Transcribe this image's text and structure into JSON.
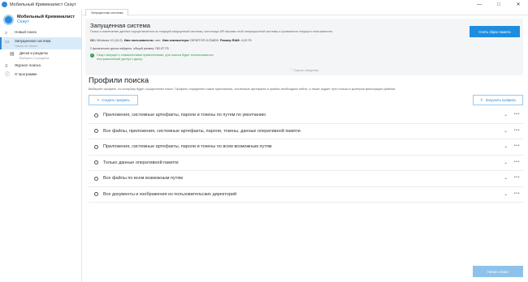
{
  "window": {
    "title": "Мобильный Криминалист Скаут",
    "controls": [
      "—",
      "□",
      "✕"
    ]
  },
  "brand": {
    "name": "Мобильный Криминалист",
    "sub": "Скаут"
  },
  "sidebar": {
    "items": [
      {
        "label": "Новый поиск",
        "sub": "",
        "icon": "search-icon"
      },
      {
        "label": "Запущенная система",
        "sub": "Поиск не начат",
        "icon": "computer-icon"
      },
      {
        "label": "Диски и разделы",
        "sub": "Выбрано 4 раздела",
        "icon": "disk-icon"
      },
      {
        "label": "Журнал поиска",
        "sub": "",
        "icon": "list-icon"
      },
      {
        "label": "О программе",
        "sub": "",
        "icon": "info-icon"
      }
    ]
  },
  "tabs": [
    {
      "label": "Запущенная система"
    }
  ],
  "system": {
    "title": "Запущенная система",
    "description": "Поиск и извлечение данных осуществляется из текущей запущенной системы, используя API вызовы этой операционной системы и привилегии текущего пользователя.",
    "os_label": "ОС:",
    "os_value": "Windows 10 (10.0)",
    "user_label": "Имя пользователя:",
    "user_value": "user",
    "pc_label": "Имя компьютера:",
    "pc_value": "DESKTOP-2LTA8D0",
    "ram_label": "Размер RAM:",
    "ram_value": "4,02 ГБ",
    "disks": "2 физических диска найдено, общий размер 782,97 ГБ",
    "ok_text": "Скаут запущен с повышенными привилегиями, для поиска будет использоваться неограниченный доступ к диску.",
    "dump_button": "Снять образ памяти",
    "hide_details": "Скрыть сведения"
  },
  "profiles": {
    "title": "Профили поиска",
    "description": "Выберите профиль, по которому будет осуществлен поиск. Профиль определяет какие приложения, системные артефакты и файлы необходимо найти, а также задает пути поиска и критерии фильтрации файлов.",
    "create_button": "Создать профиль",
    "upload_button": "Загрузить профиль",
    "items": [
      "Приложения, системные артефакты, пароли и токены по путям по умолчанию",
      "Все файлы, приложения, системные артефакты, пароли, токены, данные оперативной памяти",
      "Приложения, системные артефакты, пароли и токены по всем возможным путям",
      "Только данные оперативной памяти",
      "Все файлы по всем возможным путям",
      "Все документы и изображения из пользовательских директорий"
    ]
  },
  "run_button": "Начать поиск",
  "colors": {
    "accent": "#1e8de0",
    "success": "#2ea043",
    "active_bg": "#d9ebf9"
  }
}
